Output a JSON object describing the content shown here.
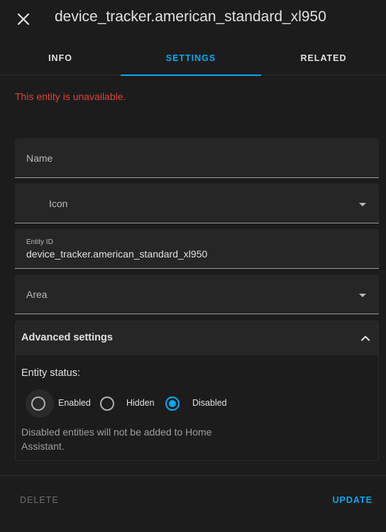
{
  "header": {
    "title": "device_tracker.american_standard_xl950",
    "close_icon": "close-icon"
  },
  "tabs": [
    {
      "label": "INFO",
      "active": false
    },
    {
      "label": "SETTINGS",
      "active": true
    },
    {
      "label": "RELATED",
      "active": false
    }
  ],
  "warning": "This entity is unavailable.",
  "form": {
    "name": {
      "label": "Name",
      "value": ""
    },
    "icon": {
      "label": "Icon",
      "value": ""
    },
    "entity_id": {
      "label": "Entity ID",
      "value": "device_tracker.american_standard_xl950"
    },
    "area": {
      "label": "Area",
      "value": ""
    }
  },
  "advanced": {
    "title": "Advanced settings",
    "expanded": true,
    "status_label": "Entity status:",
    "options": [
      {
        "label": "Enabled",
        "checked": false
      },
      {
        "label": "Hidden",
        "checked": false
      },
      {
        "label": "Disabled",
        "checked": true
      }
    ],
    "helper": "Disabled entities will not be added to Home Assistant."
  },
  "footer": {
    "delete_label": "DELETE",
    "update_label": "UPDATE"
  },
  "colors": {
    "accent": "#03a9f4",
    "error": "#db4437",
    "background": "#1c1c1c"
  }
}
